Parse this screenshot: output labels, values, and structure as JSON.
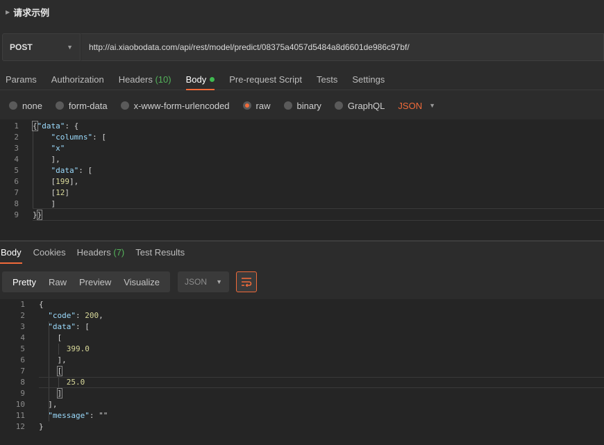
{
  "section": {
    "title": "请求示例"
  },
  "request": {
    "method": "POST",
    "url": "http://ai.xiaobodata.com/api/rest/model/predict/08375a4057d5484a8d6601de986c97bf/"
  },
  "request_tabs": {
    "params": "Params",
    "authorization": "Authorization",
    "headers": "Headers",
    "headers_count": "(10)",
    "body": "Body",
    "prerequest": "Pre-request Script",
    "tests": "Tests",
    "settings": "Settings"
  },
  "body_types": {
    "none": "none",
    "form_data": "form-data",
    "urlencoded": "x-www-form-urlencoded",
    "raw": "raw",
    "binary": "binary",
    "graphql": "GraphQL",
    "format": "JSON",
    "selected": "raw"
  },
  "request_body": {
    "line_numbers": [
      "1",
      "2",
      "3",
      "4",
      "5",
      "6",
      "7",
      "8",
      "9"
    ],
    "lines": [
      "{\"data\": {",
      "    \"columns\": [",
      "    \"x\"",
      "    ],",
      "    \"data\": [",
      "    [199],",
      "    [12]",
      "    ]",
      "}}"
    ]
  },
  "response_tabs": {
    "body": "Body",
    "cookies": "Cookies",
    "headers": "Headers",
    "headers_count": "(7)",
    "test_results": "Test Results"
  },
  "response_toolbar": {
    "pretty": "Pretty",
    "raw": "Raw",
    "preview": "Preview",
    "visualize": "Visualize",
    "format": "JSON"
  },
  "response_body": {
    "line_numbers": [
      "1",
      "2",
      "3",
      "4",
      "5",
      "6",
      "7",
      "8",
      "9",
      "10",
      "11",
      "12"
    ],
    "lines": [
      "{",
      "  \"code\": 200,",
      "  \"data\": [",
      "    [",
      "      399.0",
      "    ],",
      "    [",
      "      25.0",
      "    ]",
      "  ],",
      "  \"message\": \"\"",
      "}"
    ]
  },
  "colors": {
    "accent": "#f26b3a",
    "count_green": "#54b35b",
    "status_dot": "#3fb950"
  }
}
